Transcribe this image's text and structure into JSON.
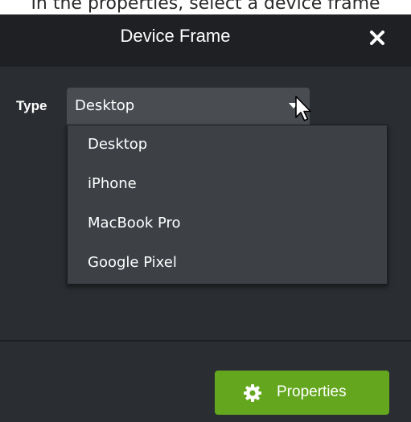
{
  "caption": "In the properties, select a device frame",
  "dialog": {
    "title": "Device Frame",
    "close_icon": "close-icon"
  },
  "type_field": {
    "label": "Type",
    "selected_value": "Desktop",
    "options": [
      "Desktop",
      "iPhone",
      "MacBook Pro",
      "Google Pixel"
    ]
  },
  "footer": {
    "properties_label": "Properties",
    "properties_icon": "gear-icon"
  },
  "colors": {
    "dialog_bg": "#2a2d31",
    "titlebar_bg": "#1e2023",
    "select_bg": "#494d52",
    "dropdown_bg": "#3d4146",
    "accent_green": "#64a71f"
  }
}
